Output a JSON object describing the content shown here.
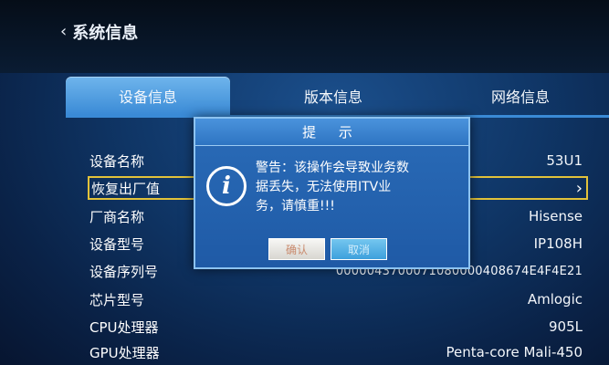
{
  "header": {
    "back_title": "系统信息"
  },
  "tabs": [
    {
      "label": "设备信息",
      "active": true
    },
    {
      "label": "版本信息",
      "active": false
    },
    {
      "label": "网络信息",
      "active": false
    }
  ],
  "info_rows": [
    {
      "label": "设备名称",
      "value": "53U1"
    },
    {
      "label": "恢复出厂值",
      "value": ""
    },
    {
      "label": "厂商名称",
      "value": "Hisense"
    },
    {
      "label": "设备型号",
      "value": "IP108H"
    },
    {
      "label": "设备序列号",
      "value": "0000043700071080000408674E4F4E21"
    },
    {
      "label": "芯片型号",
      "value": "Amlogic"
    },
    {
      "label": "CPU处理器",
      "value": "905L"
    },
    {
      "label": "GPU处理器",
      "value": "Penta-core Mali-450"
    }
  ],
  "dialog": {
    "title": "提 示",
    "message_line1": "警告：该操作会导致业务数",
    "message_line2": "据丢失，无法使用ITV业",
    "message_line3": "务，请慎重!!!",
    "confirm_label": "确认",
    "cancel_label": "取消"
  },
  "colors": {
    "focus_border": "#e2c23a",
    "tab_active": "#3a8ad6",
    "dialog_bg": "#1f5aa6"
  }
}
